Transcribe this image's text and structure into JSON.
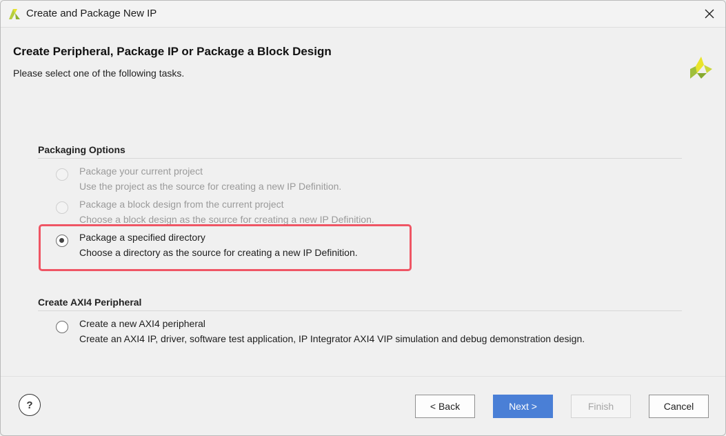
{
  "window": {
    "title": "Create and Package New IP"
  },
  "header": {
    "title": "Create Peripheral, Package IP or Package a Block Design",
    "subtitle": "Please select one of the following tasks."
  },
  "sections": {
    "packaging": {
      "title": "Packaging Options",
      "options": [
        {
          "label": "Package your current project",
          "description": "Use the project as the source for creating a new IP Definition.",
          "state": "disabled"
        },
        {
          "label": "Package a block design from the current project",
          "description": "Choose a block design as the source for creating a new IP Definition.",
          "state": "disabled"
        },
        {
          "label": "Package a specified directory",
          "description": "Choose a directory as the source for creating a new IP Definition.",
          "state": "selected"
        }
      ]
    },
    "axi4": {
      "title": "Create AXI4 Peripheral",
      "options": [
        {
          "label": "Create a new AXI4 peripheral",
          "description": "Create an AXI4 IP, driver, software test application, IP Integrator AXI4 VIP simulation and debug demonstration design.",
          "state": "unselected"
        }
      ]
    }
  },
  "footer": {
    "help_label": "?",
    "back_label": "< Back",
    "next_label": "Next >",
    "finish_label": "Finish",
    "cancel_label": "Cancel"
  },
  "colors": {
    "highlight": "#ef5564",
    "primary_button": "#4a7fd6",
    "logo_green": "#9fbf3a",
    "logo_yellow": "#e9e42a"
  },
  "icons": {
    "app": "xilinx-logo-icon",
    "brand": "xilinx-logo-icon",
    "close": "close-icon"
  }
}
